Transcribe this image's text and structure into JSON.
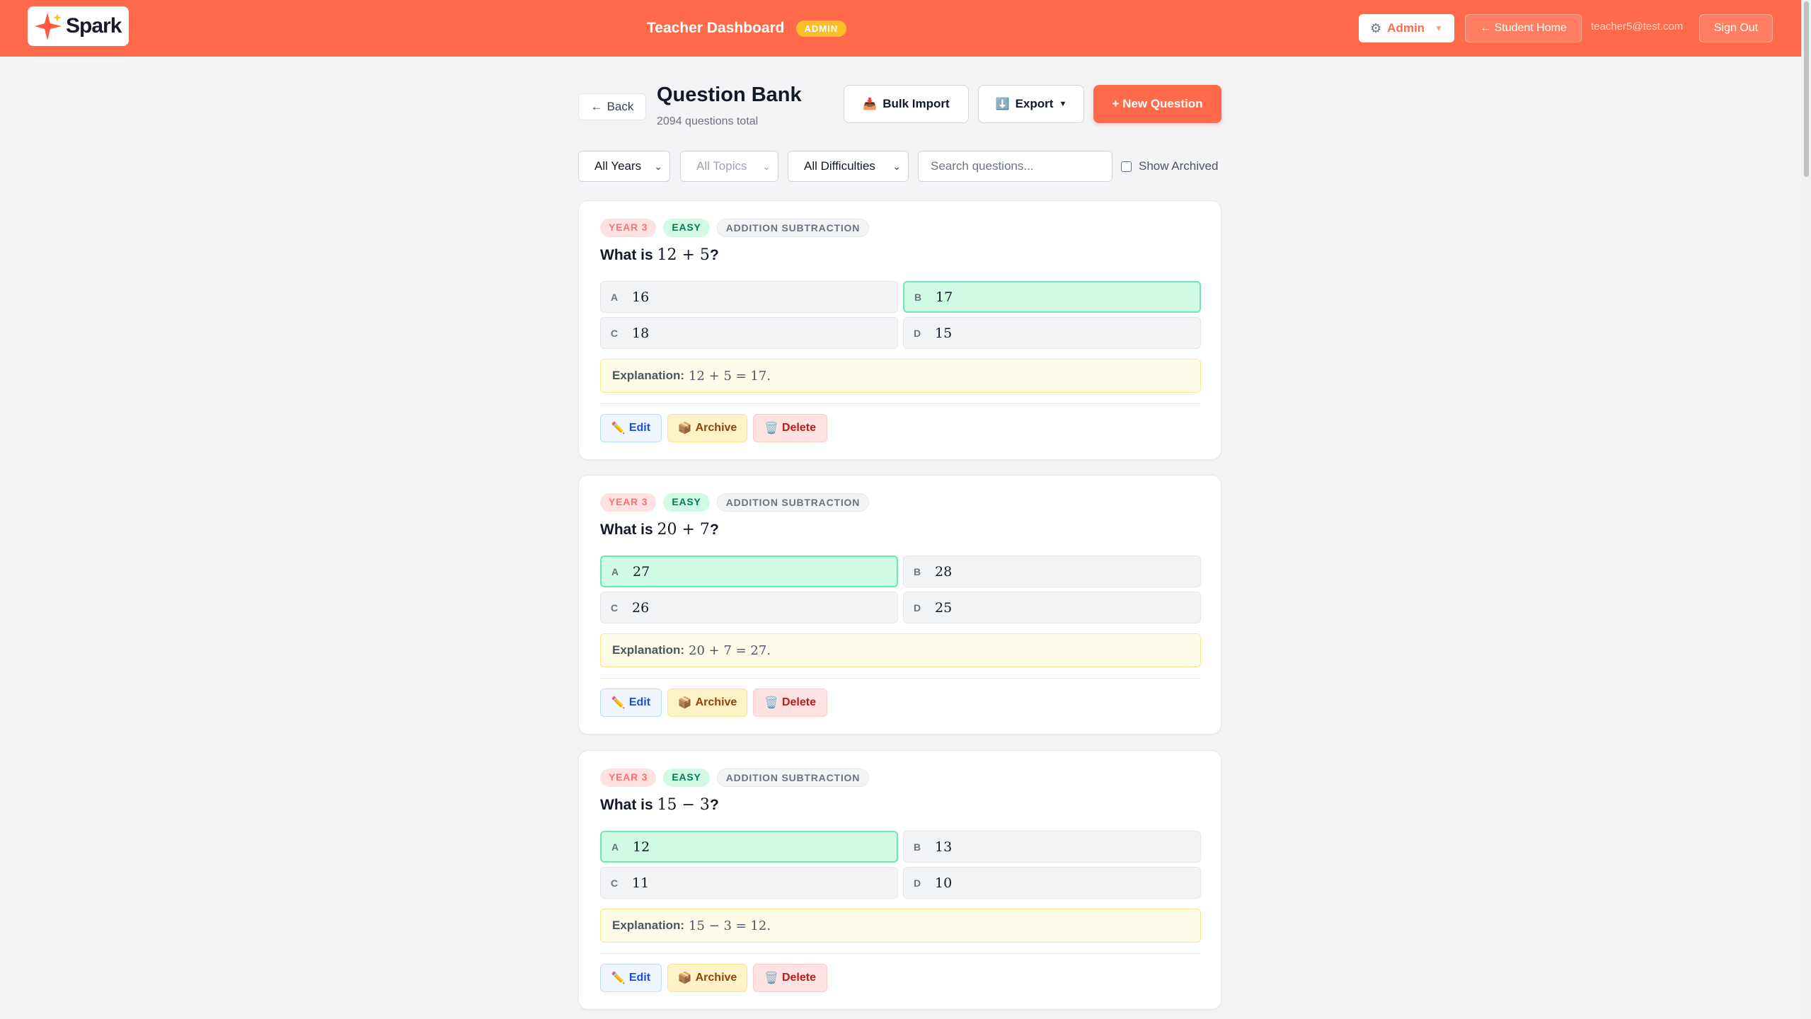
{
  "header": {
    "logo_text": "Spark",
    "title": "Teacher Dashboard",
    "role_badge": "ADMIN",
    "admin_menu": "Admin",
    "student_home": "← Student Home",
    "user_email": "teacher5@test.com",
    "sign_out": "Sign Out",
    "brand_color": "#ff6b4a"
  },
  "page": {
    "back_label": "Back",
    "title": "Question Bank",
    "subtitle": "2094 questions total",
    "bulk_import_label": "Bulk Import",
    "export_label": "Export",
    "new_question_label": "+ New Question"
  },
  "filters": {
    "year": "All Years",
    "topic": "All Topics",
    "difficulty": "All Difficulties",
    "search_placeholder": "Search questions...",
    "show_archived_label": "Show Archived",
    "show_archived_checked": false
  },
  "questions": [
    {
      "year": "YEAR 3",
      "difficulty": "EASY",
      "topic": "ADDITION SUBTRACTION",
      "prompt": "What is",
      "expr": "12 + 5",
      "options": [
        {
          "letter": "A",
          "value": "16",
          "correct": false
        },
        {
          "letter": "B",
          "value": "17",
          "correct": true
        },
        {
          "letter": "C",
          "value": "18",
          "correct": false
        },
        {
          "letter": "D",
          "value": "15",
          "correct": false
        }
      ],
      "explanation_label": "Explanation:",
      "explanation": "12 + 5 = 17."
    },
    {
      "year": "YEAR 3",
      "difficulty": "EASY",
      "topic": "ADDITION SUBTRACTION",
      "prompt": "What is",
      "expr": "20 + 7",
      "options": [
        {
          "letter": "A",
          "value": "27",
          "correct": true
        },
        {
          "letter": "B",
          "value": "28",
          "correct": false
        },
        {
          "letter": "C",
          "value": "26",
          "correct": false
        },
        {
          "letter": "D",
          "value": "25",
          "correct": false
        }
      ],
      "explanation_label": "Explanation:",
      "explanation": "20 + 7 = 27."
    },
    {
      "year": "YEAR 3",
      "difficulty": "EASY",
      "topic": "ADDITION SUBTRACTION",
      "prompt": "What is",
      "expr": "15 − 3",
      "options": [
        {
          "letter": "A",
          "value": "12",
          "correct": true
        },
        {
          "letter": "B",
          "value": "13",
          "correct": false
        },
        {
          "letter": "C",
          "value": "11",
          "correct": false
        },
        {
          "letter": "D",
          "value": "10",
          "correct": false
        }
      ],
      "explanation_label": "Explanation:",
      "explanation": "15 − 3 = 12."
    }
  ],
  "card_actions": {
    "edit": "Edit",
    "archive": "Archive",
    "delete": "Delete"
  },
  "icons": {
    "logo": "sparkle-icon",
    "admin": "gear-icon",
    "bulk_import": "inbox-tray-icon",
    "export": "download-arrow-icon",
    "edit": "pencil-icon",
    "archive": "package-icon",
    "delete": "trash-icon"
  }
}
